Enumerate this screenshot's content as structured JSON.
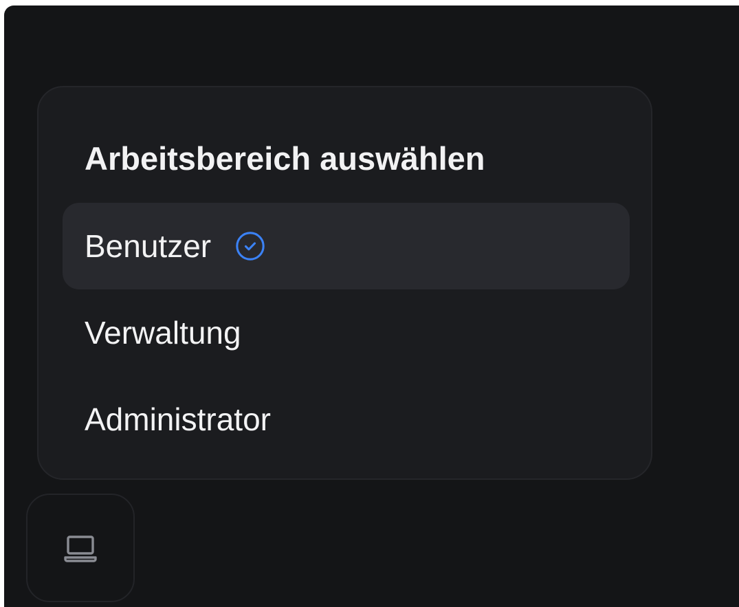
{
  "workspace_menu": {
    "title": "Arbeitsbereich auswählen",
    "options": [
      {
        "label": "Benutzer",
        "selected": true,
        "icon": "check-circle-icon"
      },
      {
        "label": "Verwaltung",
        "selected": false
      },
      {
        "label": "Administrator",
        "selected": false
      }
    ]
  },
  "device_button": {
    "icon": "laptop-icon"
  },
  "colors": {
    "accent": "#3b82f6",
    "background": "#141517",
    "popover": "#1b1c1f",
    "selected_row": "#28292e",
    "text": "#f3f3f4"
  }
}
